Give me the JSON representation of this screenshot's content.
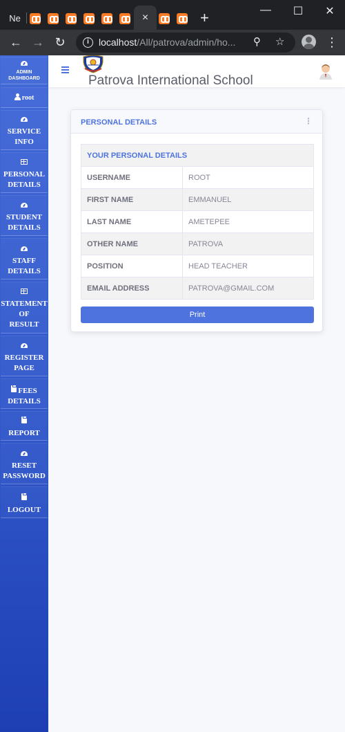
{
  "browser": {
    "first_tab_label": "Ne",
    "close_tab_glyph": "×",
    "new_tab_glyph": "+",
    "url_host": "localhost",
    "url_path": "/All/patrova/admin/ho...",
    "window_controls": {
      "minimize": "—",
      "maximize": "☐",
      "close": "✕"
    }
  },
  "sidebar": {
    "items": [
      {
        "label": "ADMIN\nDASHBOARD",
        "icon": "gauge-icon"
      },
      {
        "label": "root",
        "icon": "user-icon"
      },
      {
        "label": "SERVICE\nINFO",
        "icon": "gauge-icon"
      },
      {
        "label": "PERSONAL\nDETAILS",
        "icon": "table-icon"
      },
      {
        "label": "STUDENT\nDETAILS",
        "icon": "gauge-icon"
      },
      {
        "label": "STAFF\nDETAILS",
        "icon": "gauge-icon"
      },
      {
        "label": "STATEMENT\nOF\nRESULT",
        "icon": "table-icon"
      },
      {
        "label": "REGISTER\nPAGE",
        "icon": "gauge-icon"
      },
      {
        "label": "FEES\nDETAILS",
        "icon": "clipboard-icon"
      },
      {
        "label": "REPORT",
        "icon": "clipboard-icon"
      },
      {
        "label": "RESET\nPASSWORD",
        "icon": "gauge-icon"
      },
      {
        "label": "LOGOUT",
        "icon": "clipboard-icon"
      }
    ]
  },
  "header": {
    "school_name": "Patrova International School"
  },
  "card": {
    "title": "PERSONAL DETAILS",
    "table_heading": "YOUR PERSONAL DETAILS",
    "rows": [
      {
        "key": "USERNAME",
        "value": "ROOT"
      },
      {
        "key": "FIRST NAME",
        "value": "EMMANUEL"
      },
      {
        "key": "LAST NAME",
        "value": "AMETEPEE"
      },
      {
        "key": "OTHER NAME",
        "value": "PATROVA"
      },
      {
        "key": "POSITION",
        "value": "HEAD TEACHER"
      },
      {
        "key": "EMAIL ADDRESS",
        "value": "PATROVA@GMAIL.COM"
      }
    ],
    "print_label": "Print"
  },
  "colors": {
    "primary": "#4e73df",
    "sidebar_top": "#4169d8",
    "sidebar_bottom": "#1d3fb3",
    "browser_dark": "#202124"
  }
}
